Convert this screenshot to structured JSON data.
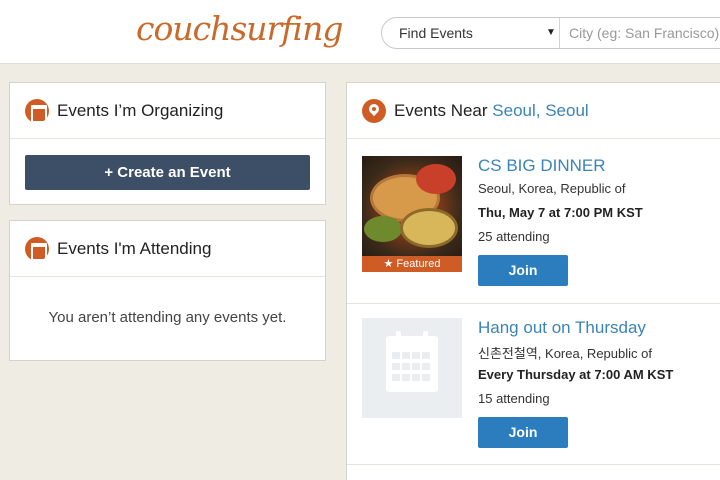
{
  "header": {
    "logo": "couchsurfing",
    "search": {
      "selected": "Find Events",
      "city_placeholder": "City (eg: San Francisco)"
    }
  },
  "organizing": {
    "title": "Events I’m Organizing",
    "create_label": "+ Create an Event"
  },
  "attending": {
    "title": "Events I'm Attending",
    "empty": "You aren’t attending any events yet."
  },
  "nearby": {
    "title_prefix": "Events Near",
    "location": "Seoul, Seoul",
    "events": [
      {
        "title": "CS BIG DINNER",
        "location": "Seoul, Korea, Republic of",
        "time": "Thu, May 7 at 7:00 PM KST",
        "attending": "25 attending",
        "badge": "★ Featured",
        "join_label": "Join"
      },
      {
        "title": "Hang out on Thursday",
        "location": "신촌전철역, Korea, Republic of",
        "time": "Every Thursday at 7:00 AM KST",
        "attending": "15 attending",
        "join_label": "Join"
      }
    ]
  },
  "colors": {
    "brand_orange": "#d05c25",
    "link_blue": "#3a84b7",
    "join_blue": "#2c7dbd",
    "create_navy": "#3c4f66",
    "background": "#efece3"
  }
}
